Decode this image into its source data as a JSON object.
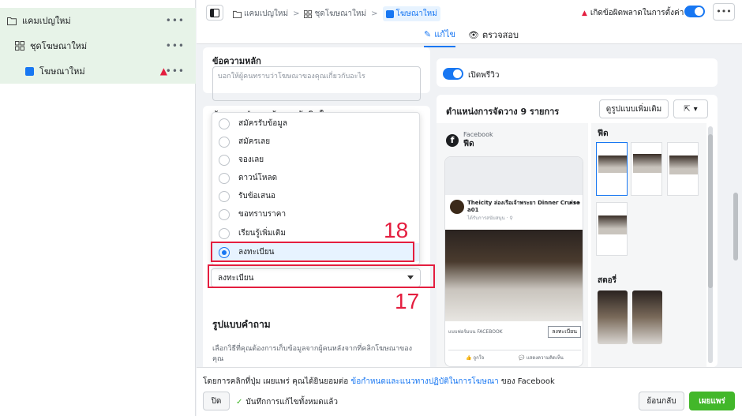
{
  "sidebar": {
    "items": [
      {
        "label": "แคมเปญใหม่",
        "icon": "folder-icon"
      },
      {
        "label": "ชุดโฆษณาใหม่",
        "icon": "grid-icon"
      },
      {
        "label": "โฆษณาใหม่",
        "icon": "ad-square-icon"
      }
    ],
    "more": "•••"
  },
  "topbar": {
    "breadcrumbs": [
      "แคมเปญใหม่",
      "ชุดโฆษณาใหม่",
      "โฆษณาใหม่"
    ],
    "error_text": "เกิดข้อผิดพลาดในการตั้งค่า",
    "more": "•••",
    "tabs": [
      "แก้ไข",
      "ตรวจสอบ"
    ]
  },
  "editor": {
    "primary_text_label": "ข้อความหลัก",
    "primary_text_placeholder": "บอกให้ผู้คนทราบว่าโฆษณาของคุณเกี่ยวกับอะไร",
    "partial_label": "ข้อความปุ่มกระตุ้นการตัดสินใจ",
    "options": [
      "สมัครรับข้อมูล",
      "สมัครเลย",
      "จองเลย",
      "ดาวน์โหลด",
      "รับข้อเสนอ",
      "ขอทราบราคา",
      "เรียนรู้เพิ่มเติม",
      "ลงทะเบียน"
    ],
    "selected_value": "ลงทะเบียน",
    "form_type_title": "รูปแบบคำถาม",
    "form_type_desc": "เลือกวิธีที่คุณต้องการเก็บข้อมูลจากผู้คนหลังจากที่คลิกโฆษณาของคุณ"
  },
  "annotations": {
    "dropdown_num": "18",
    "select_num": "17"
  },
  "preview": {
    "toggle_label": "เปิดพรีวิว",
    "title": "ตำแหน่งการจัดวาง 9 รายการ",
    "more_btn": "ดูรูปแบบเพิ่มเติม",
    "fb_label": "Facebook",
    "feed_label": "ฟีด",
    "post_title": "Theicity ล่องเรือเจ้าพระยา Dinner Cruise a01",
    "post_sub": "ได้รับการสนับสนุน · ⚲",
    "cta_source": "แบบฟอร์มบน FACEBOOK",
    "cta_button": "ลงทะเบียน",
    "like": "ถูกใจ",
    "comment": "แสดงความคิดเห็น",
    "side_feed": "ฟีด",
    "side_story": "สตอรี่"
  },
  "footer": {
    "terms_prefix": "โดยการคลิกที่ปุ่ม เผยแพร่ คุณได้ยินยอมต่อ ",
    "terms_link": "ข้อกำหนดและแนวทางปฏิบัติในการโฆษณา",
    "terms_suffix": " ของ Facebook",
    "close": "ปิด",
    "saved": "บันทึกการแก้ไขทั้งหมดแล้ว",
    "back": "ย้อนกลับ",
    "publish": "เผยแพร่"
  },
  "colors": {
    "accent": "#1877f2",
    "error": "#e41e3f",
    "publish": "#42b72a",
    "sidebar_highlight": "#e7f3e8"
  }
}
